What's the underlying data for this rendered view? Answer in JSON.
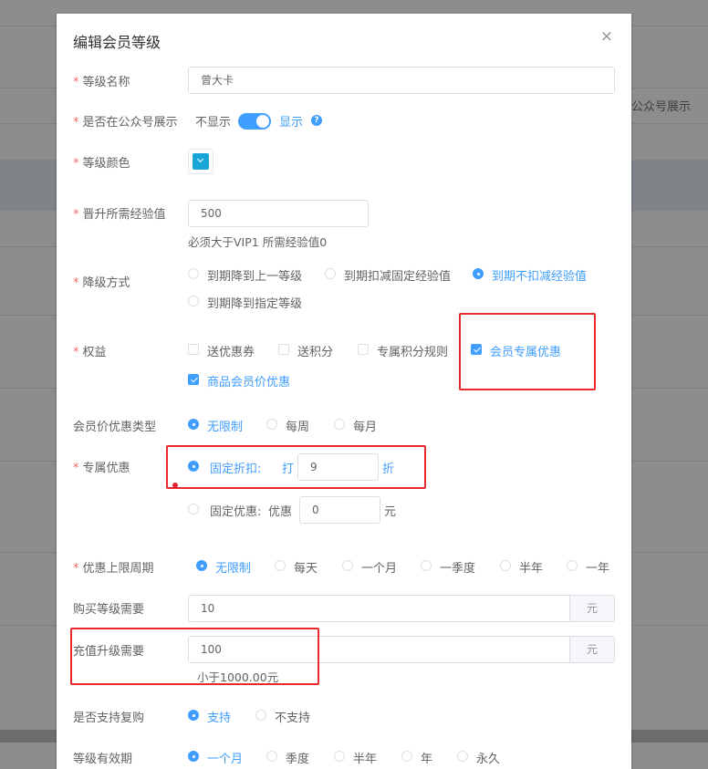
{
  "background": {
    "side_text": "公众号展示"
  },
  "dialog": {
    "title": "编辑会员等级",
    "close_glyph": "×"
  },
  "form": {
    "level_name": {
      "label": "等级名称",
      "value": "曾大卡",
      "required": "*"
    },
    "show_public": {
      "label": "是否在公众号展示",
      "off_text": "不显示",
      "on_text": "显示",
      "help_glyph": "?",
      "enabled": true,
      "required": "*"
    },
    "level_color": {
      "label": "等级颜色",
      "value": "#1aa5d8",
      "required": "*"
    },
    "exp_required": {
      "label": "晋升所需经验值",
      "value": "500",
      "hint": "必须大于VIP1 所需经验值0",
      "required": "*"
    },
    "downgrade": {
      "label": "降级方式",
      "required": "*",
      "options": [
        "到期降到上一等级",
        "到期扣减固定经验值",
        "到期不扣减经验值",
        "到期降到指定等级"
      ],
      "selected": "到期不扣减经验值"
    },
    "benefits": {
      "label": "权益",
      "required": "*",
      "options": [
        "送优惠券",
        "送积分",
        "专属积分规则",
        "会员专属优惠",
        "商品会员价优惠"
      ],
      "checked": [
        "会员专属优惠",
        "商品会员价优惠"
      ]
    },
    "price_discount_type": {
      "label": "会员价优惠类型",
      "options": [
        "无限制",
        "每周",
        "每月"
      ],
      "selected": "无限制"
    },
    "exclusive": {
      "label": "专属优惠",
      "required": "*",
      "fixed_discount": {
        "label": "固定折扣:",
        "prefix": "打",
        "value": "9",
        "suffix": "折",
        "selected": true
      },
      "fixed_amount": {
        "label": "固定优惠:",
        "prefix": "优惠",
        "value": "0",
        "suffix": "元",
        "selected": false
      }
    },
    "limit_period": {
      "label": "优惠上限周期",
      "required": "*",
      "options": [
        "无限制",
        "每天",
        "一个月",
        "一季度",
        "半年",
        "一年"
      ],
      "selected": "无限制"
    },
    "purchase_need": {
      "label": "购买等级需要",
      "value": "10",
      "unit": "元"
    },
    "recharge_need": {
      "label": "充值升级需要",
      "value": "100",
      "unit": "元",
      "hint": "小于1000.00元"
    },
    "repurchase": {
      "label": "是否支持复购",
      "options": [
        "支持",
        "不支持"
      ],
      "selected": "支持"
    },
    "validity": {
      "label": "等级有效期",
      "options": [
        "一个月",
        "季度",
        "半年",
        "年",
        "永久"
      ],
      "selected": "一个月"
    }
  }
}
